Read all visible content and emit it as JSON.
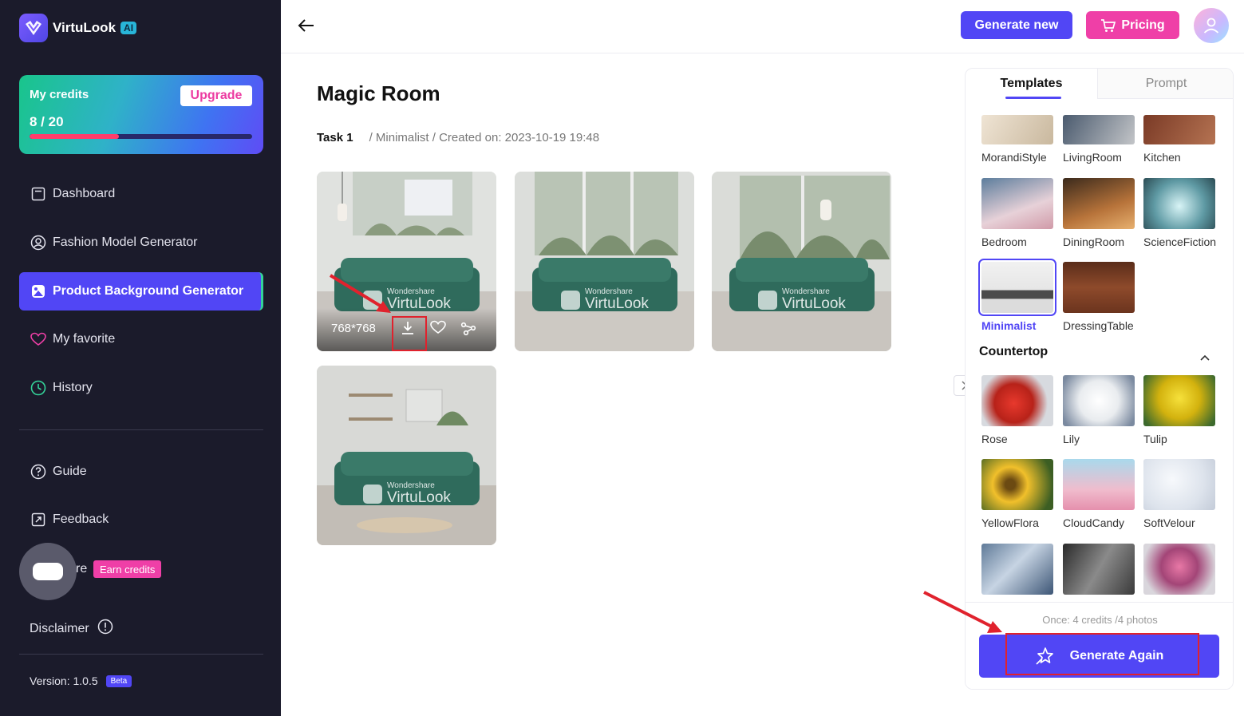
{
  "app": {
    "name": "VirtuLook",
    "badge": "AI"
  },
  "credits": {
    "title": "My credits",
    "count": "8 / 20",
    "used": 8,
    "total": 20,
    "upgrade_label": "Upgrade"
  },
  "nav": {
    "dashboard": "Dashboard",
    "fashion": "Fashion Model Generator",
    "product": "Product Background Generator",
    "favorite": "My favorite",
    "history": "History",
    "guide": "Guide",
    "feedback": "Feedback",
    "share_tail": "re",
    "earn": "Earn credits",
    "disclaimer": "Disclaimer",
    "version": "Version: 1.0.5",
    "beta": "Beta"
  },
  "topbar": {
    "generate_new": "Generate new",
    "pricing": "Pricing"
  },
  "main": {
    "title": "Magic Room",
    "task": "Task 1",
    "meta": "/ Minimalist / Created on: 2023-10-19 19:48",
    "size": "768*768",
    "watermark_small": "Wondershare",
    "watermark_big": "VirtuLook"
  },
  "panel": {
    "tabs": {
      "templates": "Templates",
      "prompt": "Prompt"
    },
    "templates": [
      "MorandiStyle",
      "LivingRoom",
      "Kitchen",
      "Bedroom",
      "DiningRoom",
      "ScienceFiction",
      "Minimalist",
      "DressingTable"
    ],
    "selected": "Minimalist",
    "section": "Countertop",
    "countertop": [
      "Rose",
      "Lily",
      "Tulip",
      "YellowFlora",
      "CloudCandy",
      "SoftVelour"
    ],
    "cost_note": "Once: 4 credits /4 photos",
    "generate_again": "Generate Again"
  },
  "colors": {
    "accent": "#5146f5",
    "pink": "#ef3fa7",
    "sidebar": "#1b1b2b"
  }
}
